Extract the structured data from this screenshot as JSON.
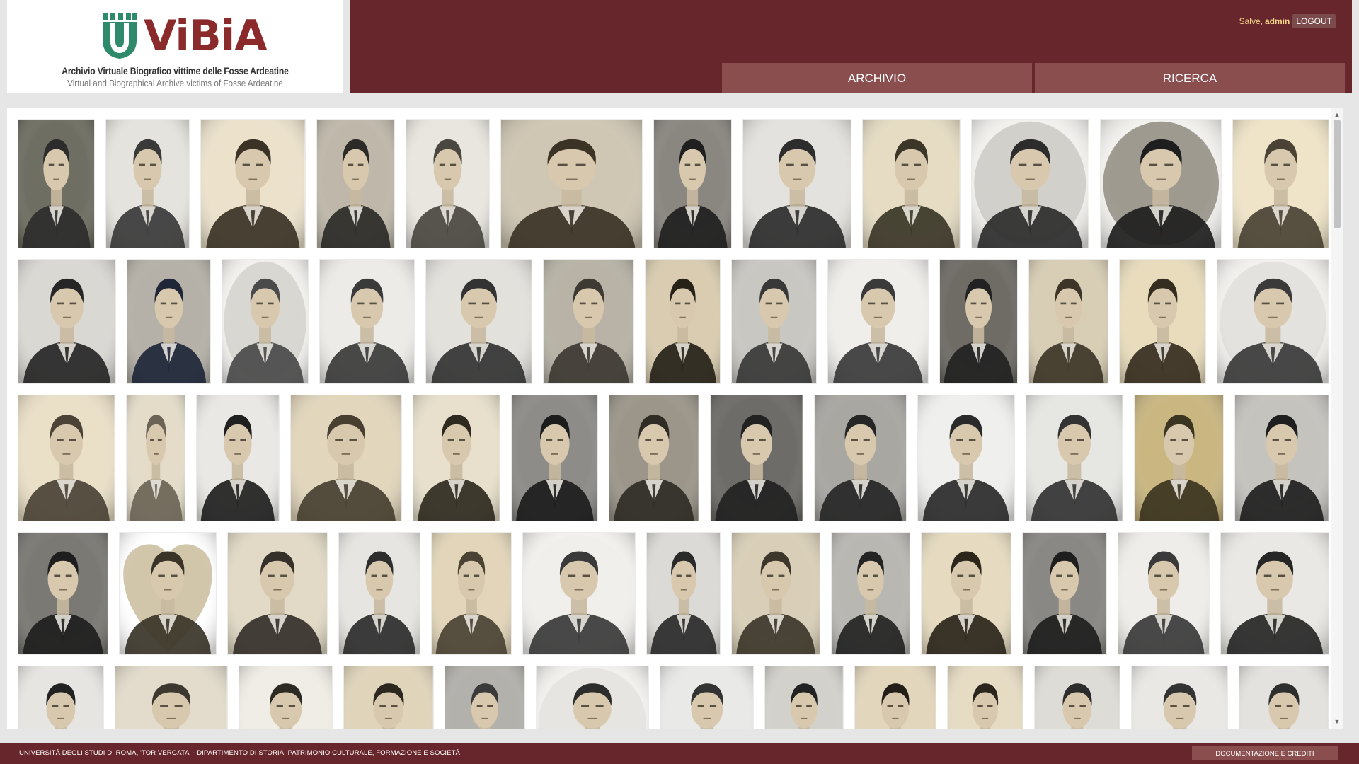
{
  "app": {
    "logo_text": "ViBiA",
    "subtitle_it": "Archivio Virtuale Biografico vittime delle Fosse Ardeatine",
    "subtitle_en": "Virtual and Biographical Archive victims of Fosse Ardeatine",
    "brand_color": "#67262b",
    "logo_icon": "green-tower-shield-icon"
  },
  "header": {
    "greeting": "Salve,",
    "username": "admin",
    "logout_label": "LOGOUT"
  },
  "nav": {
    "archivio_label": "ARCHIVIO",
    "ricerca_label": "RICERCA"
  },
  "gallery": {
    "rows": [
      [
        {
          "w": 110,
          "tone": "#2c2c2c",
          "bg": "#6e6e62",
          "shape": "rect"
        },
        {
          "w": 120,
          "tone": "#3a3a3a",
          "bg": "#e5e3dd",
          "shape": "rect"
        },
        {
          "w": 150,
          "tone": "#3a3326",
          "bg": "#ece2cc",
          "shape": "rect"
        },
        {
          "w": 112,
          "tone": "#2b2a27",
          "bg": "#bfb8aa",
          "shape": "rect"
        },
        {
          "w": 120,
          "tone": "#4a4740",
          "bg": "#e9e6df",
          "shape": "rect"
        },
        {
          "w": 203,
          "tone": "#3b3326",
          "bg": "#cfc6b3",
          "shape": "rect"
        },
        {
          "w": 112,
          "tone": "#1f1f1f",
          "bg": "#8a8680",
          "shape": "rect"
        },
        {
          "w": 156,
          "tone": "#2d2d2d",
          "bg": "#e4e2de",
          "shape": "rect"
        },
        {
          "w": 140,
          "tone": "#3b3628",
          "bg": "#e6dcc3",
          "shape": "rect"
        },
        {
          "w": 168,
          "tone": "#2c2c2c",
          "bg": "#d2d0cb",
          "shape": "oval"
        },
        {
          "w": 174,
          "tone": "#1e1e1e",
          "bg": "#9e9a90",
          "shape": "oval"
        },
        {
          "w": 138,
          "tone": "#4a4234",
          "bg": "#efe4c8",
          "shape": "rect"
        }
      ],
      [
        {
          "w": 140,
          "tone": "#262626",
          "bg": "#dad8d3",
          "shape": "rect"
        },
        {
          "w": 120,
          "tone": "#1e2638",
          "bg": "#b5b1a8",
          "shape": "rect"
        },
        {
          "w": 124,
          "tone": "#4a4a4a",
          "bg": "#d9d7d2",
          "shape": "oval"
        },
        {
          "w": 136,
          "tone": "#3a3a3a",
          "bg": "#ecebe7",
          "shape": "rect"
        },
        {
          "w": 152,
          "tone": "#333333",
          "bg": "#e3e1dc",
          "shape": "rect"
        },
        {
          "w": 130,
          "tone": "#3d3a33",
          "bg": "#b8b3a6",
          "shape": "rect"
        },
        {
          "w": 108,
          "tone": "#262218",
          "bg": "#d9ccb0",
          "shape": "rect"
        },
        {
          "w": 122,
          "tone": "#383838",
          "bg": "#c9c7c2",
          "shape": "rect"
        },
        {
          "w": 144,
          "tone": "#3a3a3a",
          "bg": "#efeeeb",
          "shape": "rect"
        },
        {
          "w": 112,
          "tone": "#222222",
          "bg": "#6f6c66",
          "shape": "rect"
        },
        {
          "w": 114,
          "tone": "#3d3628",
          "bg": "#d8ceb5",
          "shape": "rect"
        },
        {
          "w": 124,
          "tone": "#352d1f",
          "bg": "#e8dcbc",
          "shape": "rect"
        },
        {
          "w": 160,
          "tone": "#3a3a3a",
          "bg": "#e4e2de",
          "shape": "oval"
        }
      ],
      [
        {
          "w": 138,
          "tone": "#4a4336",
          "bg": "#eadfc7",
          "shape": "rect"
        },
        {
          "w": 85,
          "tone": "#6b6456",
          "bg": "#e4dcc9",
          "shape": "rect"
        },
        {
          "w": 118,
          "tone": "#1f1f1f",
          "bg": "#e9e8e4",
          "shape": "rect"
        },
        {
          "w": 158,
          "tone": "#473f30",
          "bg": "#e2d6bc",
          "shape": "rect"
        },
        {
          "w": 124,
          "tone": "#2f2a20",
          "bg": "#e8e0cc",
          "shape": "rect"
        },
        {
          "w": 124,
          "tone": "#1c1c1c",
          "bg": "#8d8c88",
          "shape": "rect"
        },
        {
          "w": 128,
          "tone": "#2f2c26",
          "bg": "#9c968a",
          "shape": "rect"
        },
        {
          "w": 132,
          "tone": "#222222",
          "bg": "#6e6c68",
          "shape": "rect"
        },
        {
          "w": 132,
          "tone": "#262626",
          "bg": "#a9a7a2",
          "shape": "rect"
        },
        {
          "w": 138,
          "tone": "#2a2a2a",
          "bg": "#efefed",
          "shape": "rect"
        },
        {
          "w": 138,
          "tone": "#333333",
          "bg": "#e6e6e3",
          "shape": "rect"
        },
        {
          "w": 128,
          "tone": "#3b3420",
          "bg": "#c9b681",
          "shape": "rect"
        },
        {
          "w": 134,
          "tone": "#1f1f1f",
          "bg": "#c5c3be",
          "shape": "rect"
        }
      ],
      [
        {
          "w": 128,
          "tone": "#1e1e1e",
          "bg": "#7a7974",
          "shape": "rect"
        },
        {
          "w": 138,
          "tone": "#3a3428",
          "bg": "#d2c6aa",
          "shape": "heart"
        },
        {
          "w": 142,
          "tone": "#35302a",
          "bg": "#e2dac6",
          "shape": "rect"
        },
        {
          "w": 116,
          "tone": "#2d2d2d",
          "bg": "#e6e5e1",
          "shape": "rect"
        },
        {
          "w": 114,
          "tone": "#4a4233",
          "bg": "#e2d5b9",
          "shape": "rect"
        },
        {
          "w": 160,
          "tone": "#3a3a3a",
          "bg": "#f0efec",
          "shape": "oval"
        },
        {
          "w": 106,
          "tone": "#2a2a2a",
          "bg": "#dcdad6",
          "shape": "rect"
        },
        {
          "w": 126,
          "tone": "#3d372b",
          "bg": "#d9cfb8",
          "shape": "rect"
        },
        {
          "w": 112,
          "tone": "#232323",
          "bg": "#b9b7b2",
          "shape": "rect"
        },
        {
          "w": 128,
          "tone": "#2b251a",
          "bg": "#e6dbc0",
          "shape": "rect"
        },
        {
          "w": 120,
          "tone": "#1e1e1e",
          "bg": "#8a8884",
          "shape": "rect"
        },
        {
          "w": 130,
          "tone": "#3a3a3a",
          "bg": "#eeede9",
          "shape": "rect"
        },
        {
          "w": 154,
          "tone": "#262626",
          "bg": "#e9e8e4",
          "shape": "rect"
        }
      ],
      [
        {
          "w": 122,
          "tone": "#222222",
          "bg": "#e6e5e1",
          "shape": "rect"
        },
        {
          "w": 160,
          "tone": "#3c372f",
          "bg": "#e3dccc",
          "shape": "rect"
        },
        {
          "w": 134,
          "tone": "#2d2a24",
          "bg": "#f0ede6",
          "shape": "rect"
        },
        {
          "w": 128,
          "tone": "#2c2820",
          "bg": "#e0d5bb",
          "shape": "rect"
        },
        {
          "w": 114,
          "tone": "#3a3a3a",
          "bg": "#b3b1ac",
          "shape": "rect"
        },
        {
          "w": 160,
          "tone": "#2c2c2c",
          "bg": "#e6e5e2",
          "shape": "oval"
        },
        {
          "w": 134,
          "tone": "#333333",
          "bg": "#e9e9e7",
          "shape": "rect"
        },
        {
          "w": 112,
          "tone": "#222222",
          "bg": "#d3d1cc",
          "shape": "rect"
        },
        {
          "w": 116,
          "tone": "#231f18",
          "bg": "#e2d6bc",
          "shape": "rect"
        },
        {
          "w": 108,
          "tone": "#2b261d",
          "bg": "#e6dbc3",
          "shape": "rect"
        },
        {
          "w": 122,
          "tone": "#2c2c2c",
          "bg": "#dedcd6",
          "shape": "rect"
        },
        {
          "w": 138,
          "tone": "#333333",
          "bg": "#e9e8e5",
          "shape": "rect"
        },
        {
          "w": 128,
          "tone": "#2e2e2e",
          "bg": "#e3e2de",
          "shape": "rect"
        }
      ]
    ]
  },
  "footer": {
    "university_text": "UNIVERSITÀ DEGLI STUDI DI ROMA, 'TOR VERGATA' - DIPARTIMENTO DI STORIA, PATRIMONIO CULTURALE, FORMAZIONE E SOCIETÀ",
    "credits_label": "DOCUMENTAZIONE E CREDITI"
  }
}
